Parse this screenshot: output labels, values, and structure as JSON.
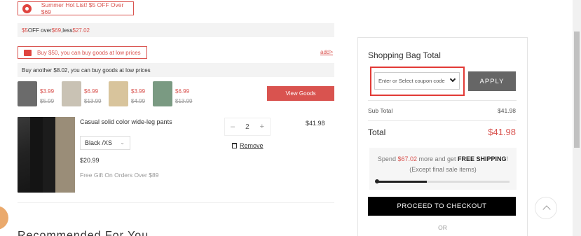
{
  "promos": {
    "hot_list": "Summer Hot List! $5 OFF Over $69",
    "discount": {
      "p1": "$5",
      "p2": " OFF over ",
      "p3": "$69",
      "p4": ",less ",
      "p5": "$27.02"
    },
    "buy50": "Buy $50, you can buy goods at low prices",
    "add_link": "add>",
    "another": "Buy another $8.02, you can buy goods at low prices"
  },
  "addons": [
    {
      "now": "$3.99",
      "was": "$5.99",
      "color": "#6b6b6b"
    },
    {
      "now": "$6.99",
      "was": "$13.99",
      "color": "#c9c2b4"
    },
    {
      "now": "$3.99",
      "was": "$4.99",
      "color": "#d8c49c"
    },
    {
      "now": "$6.99",
      "was": "$13.99",
      "color": "#7a9a82"
    }
  ],
  "view_goods": "View Goods",
  "item": {
    "name": "Casual solid color wide-leg pants",
    "variant": "Black /XS",
    "price": "$20.99",
    "gift": "Free Gift On Orders Over $89",
    "qty": "2",
    "minus": "–",
    "plus": "+",
    "remove": "Remove",
    "line_total": "$41.98"
  },
  "recommend_title": "Recommended For You",
  "summary": {
    "title": "Shopping Bag Total",
    "coupon_placeholder": "Enter or Select coupon code",
    "apply": "APPLY",
    "subtotal_label": "Sub Total",
    "subtotal": "$41.98",
    "total_label": "Total",
    "total": "$41.98",
    "ship_spend": "Spend ",
    "ship_amount": "$67.02",
    "ship_mid": " more and get ",
    "ship_free": "FREE SHIPPING",
    "ship_end": "! (Except final sale items)",
    "ship_progress": 0.38,
    "checkout": "PROCEED TO CHECKOUT",
    "or": "OR"
  },
  "colors": {
    "accent": "#d9534f",
    "highlight": "#e23a36"
  }
}
